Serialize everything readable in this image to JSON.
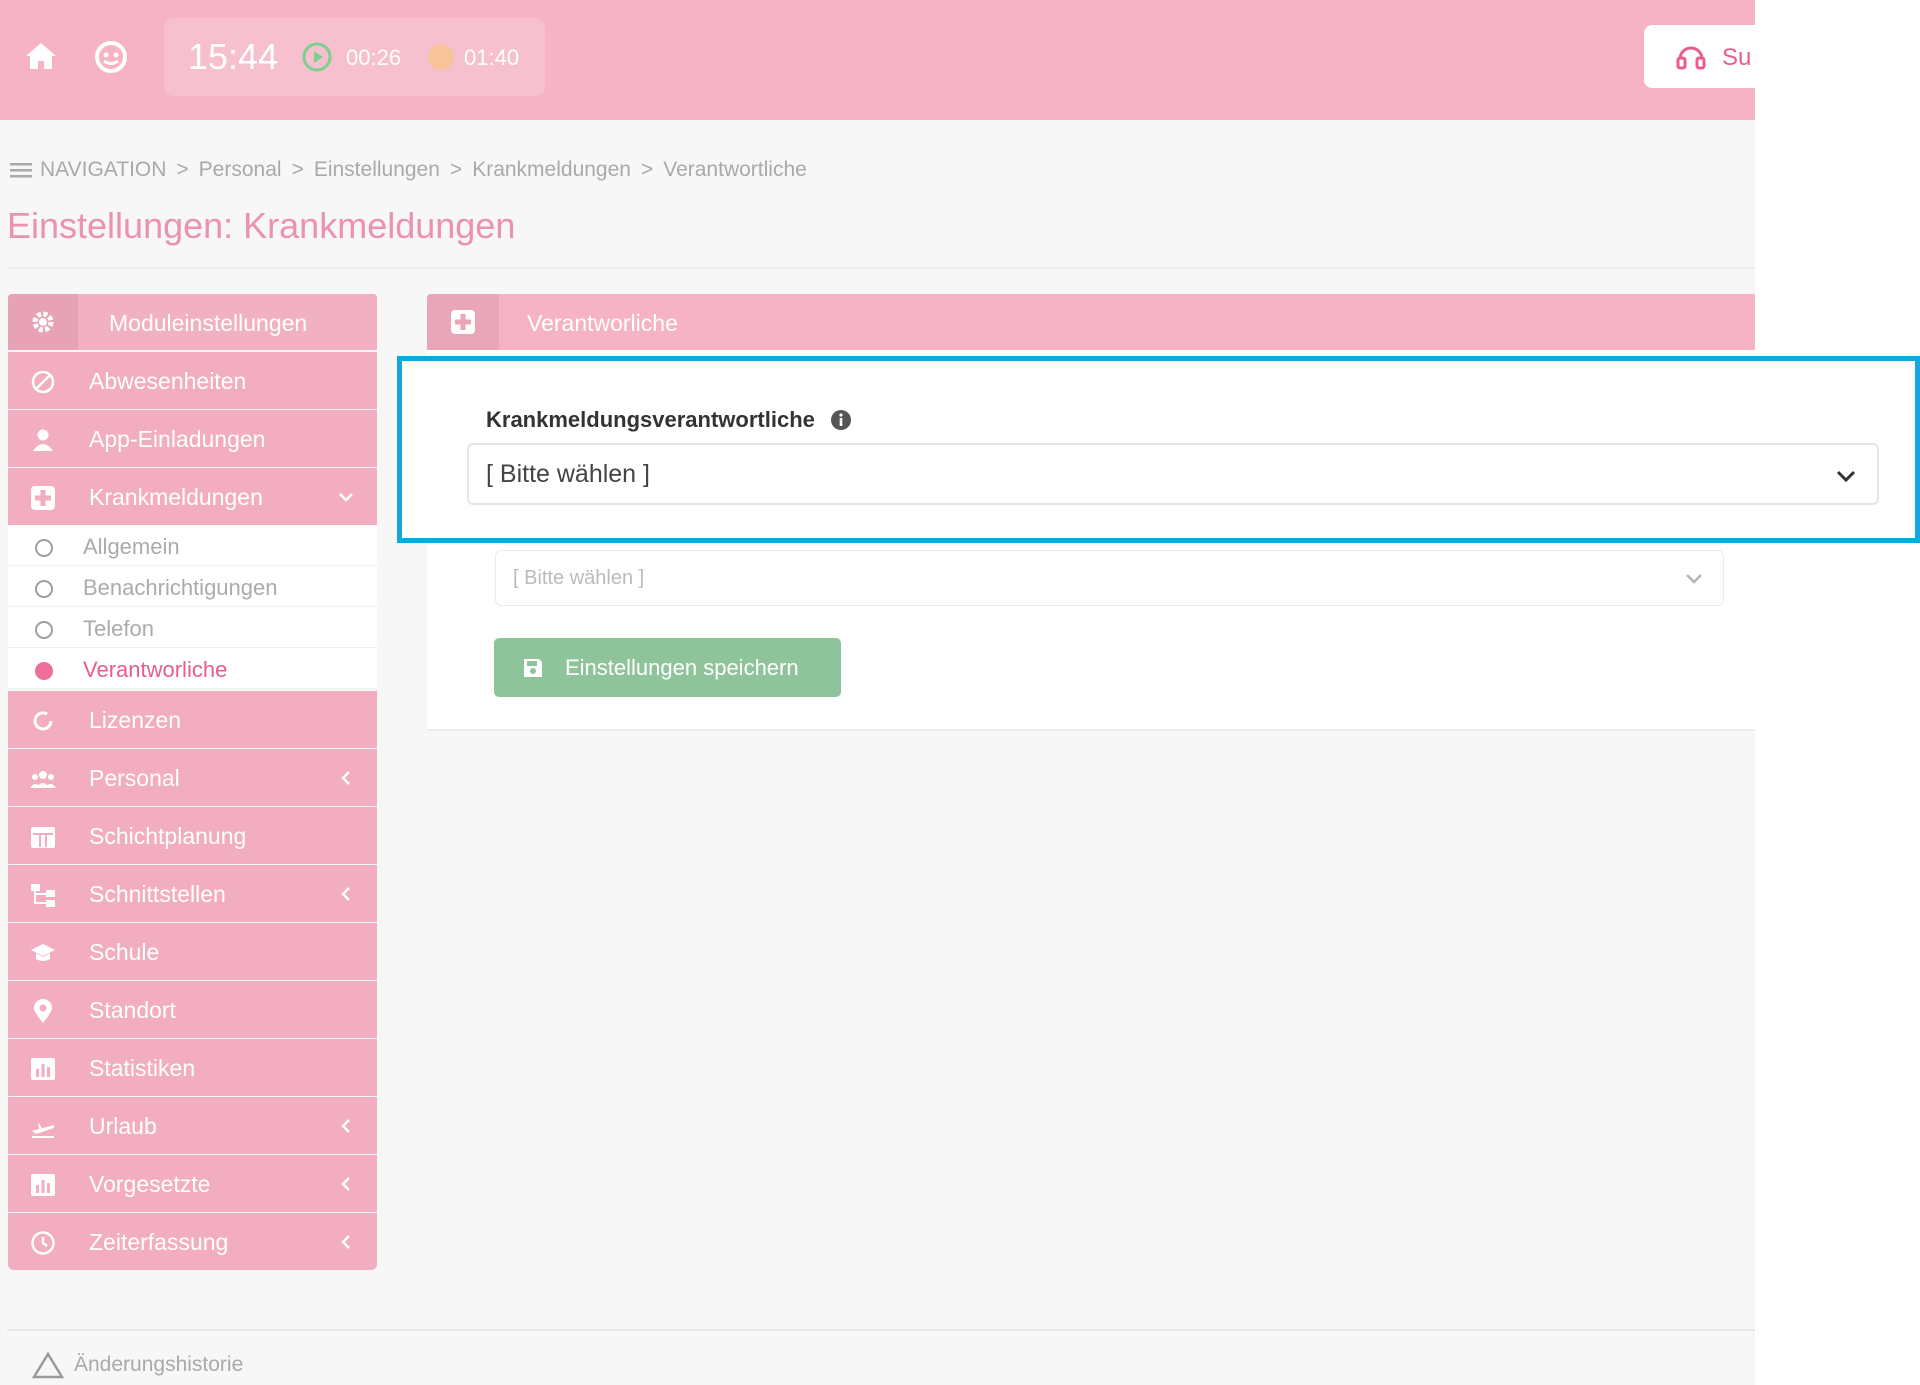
{
  "colors": {
    "topbar": "#f5b3c5",
    "sidebar_item": "#f2aec0",
    "title": "#eb92ae",
    "active_sub": "#ea5c89",
    "save_button": "#8fc49a",
    "callout_border": "#12a7e2"
  },
  "topbar": {
    "home_icon": "home-icon",
    "mascot_icon": "smiley-face-icon",
    "clock": "15:44",
    "timer_green": "00:26",
    "timer_orange": "01:40",
    "support_label": "Su",
    "support_icon": "headset-icon"
  },
  "breadcrumb": {
    "menu_icon": "hamburger-icon",
    "items": [
      "NAVIGATION",
      "Personal",
      "Einstellungen",
      "Krankmeldungen",
      "Verantwortliche"
    ],
    "separator": ">"
  },
  "page": {
    "title": "Einstellungen: Krankmeldungen"
  },
  "sidebar": {
    "header": "Moduleinstellungen",
    "items": [
      {
        "label": "Abwesenheiten",
        "icon": "ban-icon"
      },
      {
        "label": "App-Einladungen",
        "icon": "user-icon"
      },
      {
        "label": "Krankmeldungen",
        "icon": "medical-plus-icon",
        "expanded": true
      },
      {
        "label": "Lizenzen",
        "icon": "refresh-icon"
      },
      {
        "label": "Personal",
        "icon": "users-icon",
        "has_children": true
      },
      {
        "label": "Schichtplanung",
        "icon": "calendar-icon"
      },
      {
        "label": "Schnittstellen",
        "icon": "sitemap-icon",
        "has_children": true
      },
      {
        "label": "Schule",
        "icon": "graduation-cap-icon"
      },
      {
        "label": "Standort",
        "icon": "map-marker-icon"
      },
      {
        "label": "Statistiken",
        "icon": "chart-icon"
      },
      {
        "label": "Urlaub",
        "icon": "plane-icon",
        "has_children": true
      },
      {
        "label": "Vorgesetzte",
        "icon": "chart-icon",
        "has_children": true
      },
      {
        "label": "Zeiterfassung",
        "icon": "clock-icon",
        "has_children": true
      }
    ],
    "subitems": [
      {
        "label": "Allgemein",
        "active": false
      },
      {
        "label": "Benachrichtigungen",
        "active": false
      },
      {
        "label": "Telefon",
        "active": false
      },
      {
        "label": "Verantworliche",
        "active": true
      }
    ]
  },
  "panel": {
    "title": "Verantworliche",
    "ghost_select_value": "[ Bitte wählen ]",
    "save_label": "Einstellungen speichern"
  },
  "callout": {
    "field_label": "Krankmeldungsverantwortliche",
    "select_value": "[ Bitte wählen ]"
  },
  "footer": {
    "history_label": "Änderungshistorie"
  }
}
